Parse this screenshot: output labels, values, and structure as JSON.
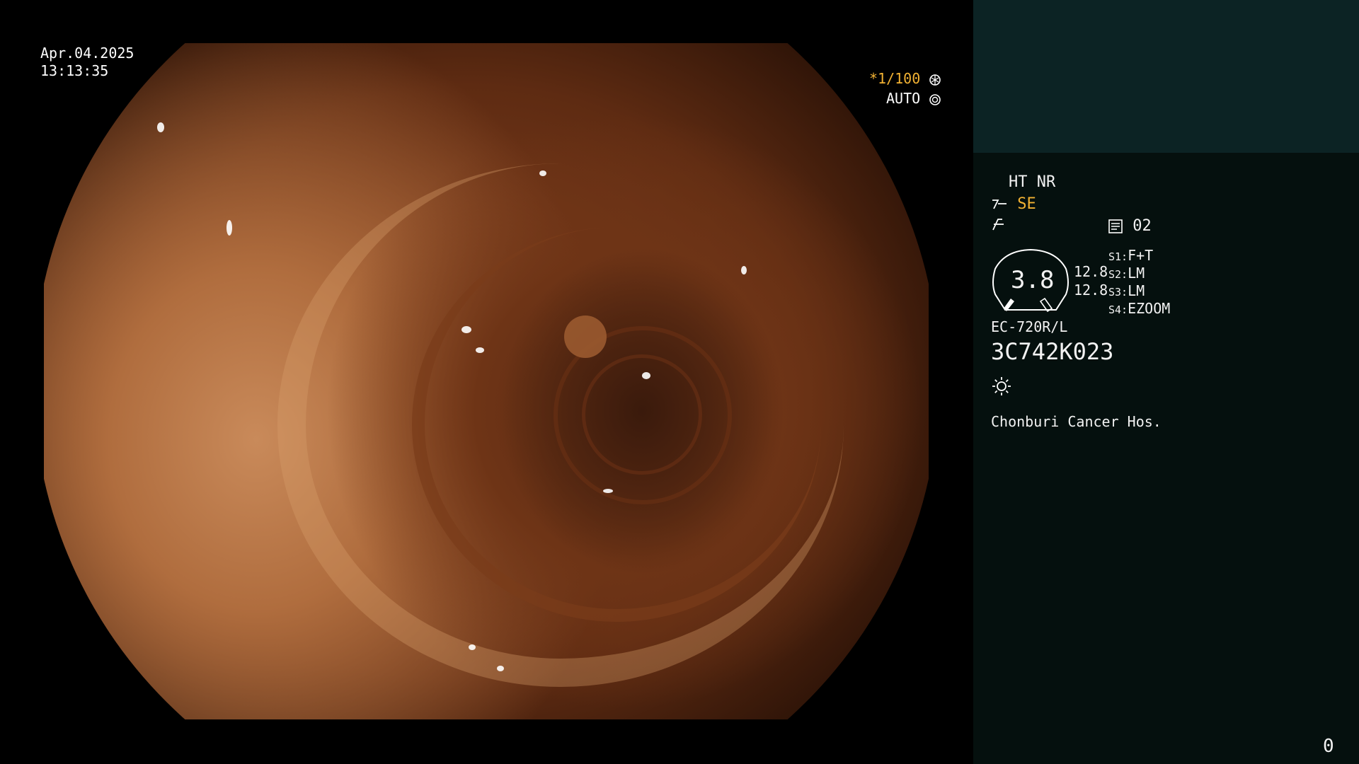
{
  "image": {
    "date": "Apr.04.2025",
    "time": "13:13:35",
    "shutter": "*1/100",
    "iris": "AUTO"
  },
  "panel": {
    "modes": "HT NR",
    "enhance": "SE",
    "memory_num": "02",
    "zoom_value": "3.8",
    "val_a": "12.8",
    "val_b": "12.8",
    "switches": [
      {
        "key": "S1:",
        "value": "F+T"
      },
      {
        "key": "S2:",
        "value": "LM"
      },
      {
        "key": "S3:",
        "value": "LM"
      },
      {
        "key": "S4:",
        "value": "EZOOM"
      }
    ],
    "scope_model": "EC-720R/L",
    "scope_serial": "3C742K023",
    "hospital": "Chonburi Cancer Hos.",
    "counter": "0"
  },
  "colors": {
    "panel_bg": "#05100e",
    "panel_top_bg": "#0c2324",
    "highlight": "#f2b233"
  },
  "icons": [
    "shutter-icon",
    "iris-icon",
    "structure-enhance-icon",
    "color-icon",
    "memory-icon",
    "brightness-icon"
  ]
}
